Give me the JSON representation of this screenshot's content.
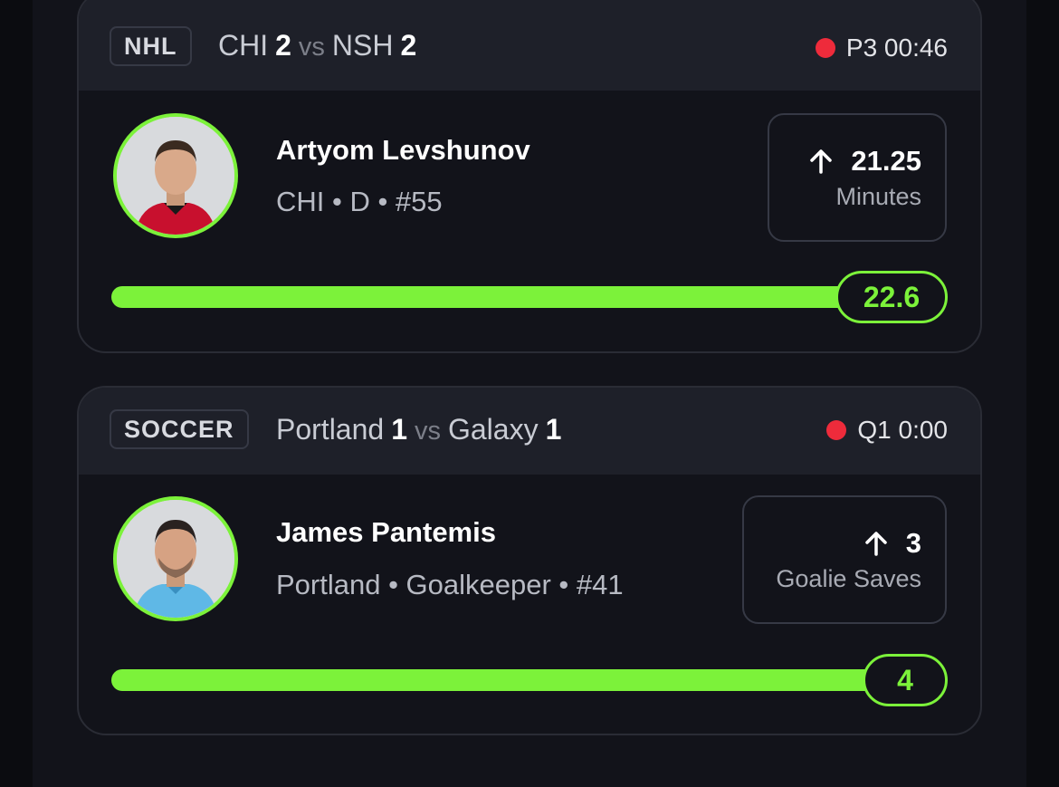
{
  "colors": {
    "accent": "#7cf23a",
    "live": "#ee2b3b",
    "card_bg": "#12131a",
    "header_bg": "#1e2029"
  },
  "cards": [
    {
      "league": "NHL",
      "home_team": "CHI",
      "home_score": "2",
      "vs": "vs",
      "away_team": "NSH",
      "away_score": "2",
      "status": "P3 00:46",
      "player_name": "Artyom Levshunov",
      "player_meta": "CHI • D • #55",
      "direction_icon": "arrow-up-icon",
      "line": "21.25",
      "stat": "Minutes",
      "current_value": "22.6",
      "progress_fraction": 1.0
    },
    {
      "league": "SOCCER",
      "home_team": "Portland",
      "home_score": "1",
      "vs": "vs",
      "away_team": "Galaxy",
      "away_score": "1",
      "status": "Q1 0:00",
      "player_name": "James Pantemis",
      "player_meta": "Portland • Goalkeeper • #41",
      "direction_icon": "arrow-up-icon",
      "line": "3",
      "stat": "Goalie Saves",
      "current_value": "4",
      "progress_fraction": 1.0
    }
  ]
}
